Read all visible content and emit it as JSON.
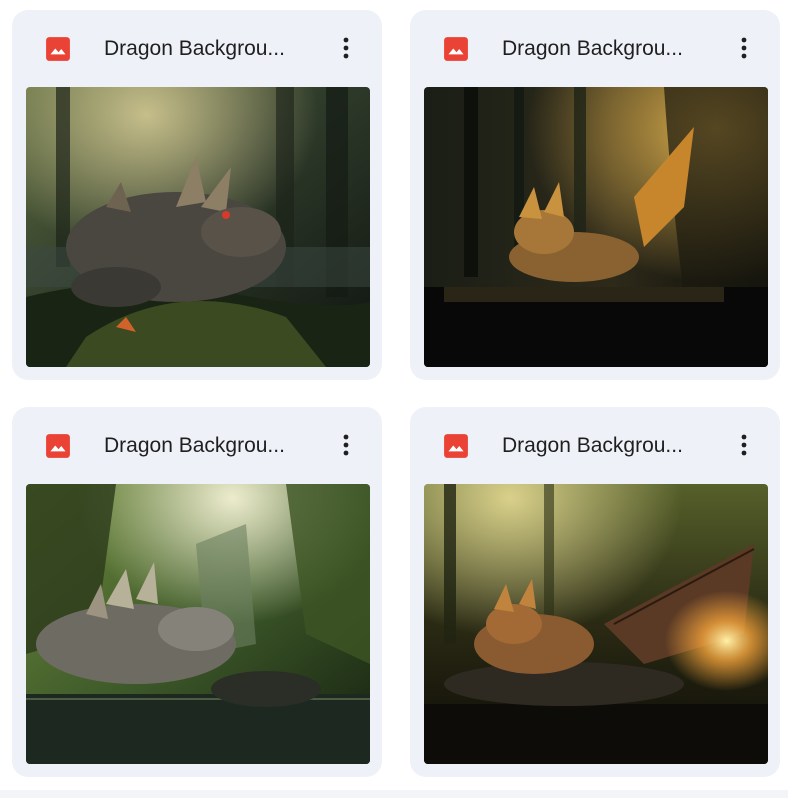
{
  "files": [
    {
      "name": "Dragon Background",
      "display_name": "Dragon Backgrou...",
      "type_icon": "image-icon",
      "menu_icon": "more-vert-icon",
      "thumbnail": "dragon-forest-red-eye"
    },
    {
      "name": "Dragon Background",
      "display_name": "Dragon Backgrou...",
      "type_icon": "image-icon",
      "menu_icon": "more-vert-icon",
      "thumbnail": "dragon-golden-light"
    },
    {
      "name": "Dragon Background",
      "display_name": "Dragon Backgrou...",
      "type_icon": "image-icon",
      "menu_icon": "more-vert-icon",
      "thumbnail": "dragon-river-green"
    },
    {
      "name": "Dragon Background",
      "display_name": "Dragon Backgrou...",
      "type_icon": "image-icon",
      "menu_icon": "more-vert-icon",
      "thumbnail": "dragon-glowing-wing"
    }
  ],
  "colors": {
    "card_bg": "#eef1f7",
    "image_icon": "#ea4335",
    "title_text": "#1f1f1f",
    "menu_icon": "#1f1f1f"
  }
}
